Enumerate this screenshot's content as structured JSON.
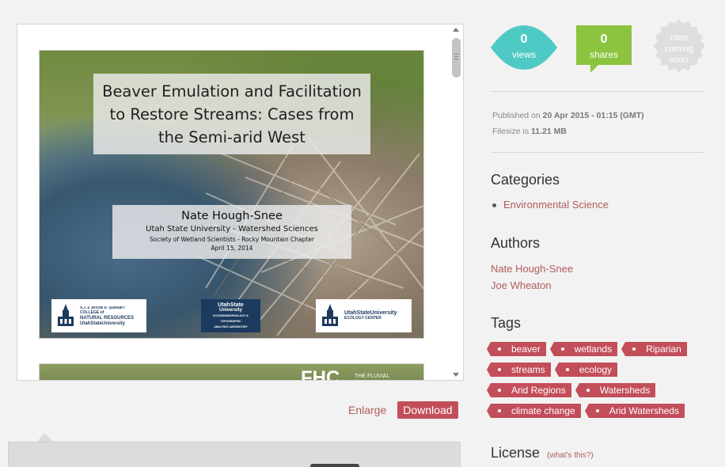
{
  "viewer": {
    "slide1": {
      "title_line1": "Beaver Emulation and Facilitation",
      "title_line2": "to Restore Streams: Cases from",
      "title_line3": "the Semi-arid West",
      "author": "Nate Hough-Snee",
      "affiliation": "Utah State University - Watershed Sciences",
      "society": "Society of Wetland Scientists - Rocky Mountain Chapter",
      "date": "April 15, 2014",
      "logo1_line1": "S.J. & JESSIE E. QUINNEY",
      "logo1_line2": "COLLEGE of",
      "logo1_line3": "NATURAL RESOURCES",
      "logo1_line4": "UtahStateUniversity",
      "logo2_line1": "UtahState",
      "logo2_line2": "University",
      "logo2_line3": "ECOGEOMORPHOLOGY & TOPOGRAPHIC",
      "logo2_line4": "ANALYSIS LABORATORY",
      "logo3_line1": "UtahStateUniversity",
      "logo3_line2": "ECOLOGY CENTER"
    },
    "slide2": {
      "text": "FHC",
      "subtext": "THE FLUVIAL"
    }
  },
  "actions": {
    "enlarge": "Enlarge",
    "download": "Download"
  },
  "stats": {
    "views_count": "0",
    "views_label": "views",
    "shares_count": "0",
    "shares_label": "shares",
    "cites_line1": "cites",
    "cites_line2": "coming",
    "cites_line3": "soon",
    "views_color": "#4fc9c4",
    "shares_color": "#8cc43f",
    "cites_color": "#dedede"
  },
  "meta": {
    "published_label": "Published on",
    "published_value": "20 Apr 2015 - 01:15 (GMT)",
    "filesize_label": "Filesize is",
    "filesize_value": "11.21 MB"
  },
  "categories": {
    "title": "Categories",
    "items": [
      "Environmental Science"
    ]
  },
  "authors": {
    "title": "Authors",
    "items": [
      "Nate Hough-Snee",
      "Joe Wheaton"
    ]
  },
  "tags": {
    "title": "Tags",
    "items": [
      "beaver",
      "wetlands",
      "Riparian",
      "streams",
      "ecology",
      "Arid Regions",
      "Watersheds",
      "climate change",
      "Arid Watersheds"
    ]
  },
  "license": {
    "title": "License",
    "link": "(what's this?)"
  }
}
